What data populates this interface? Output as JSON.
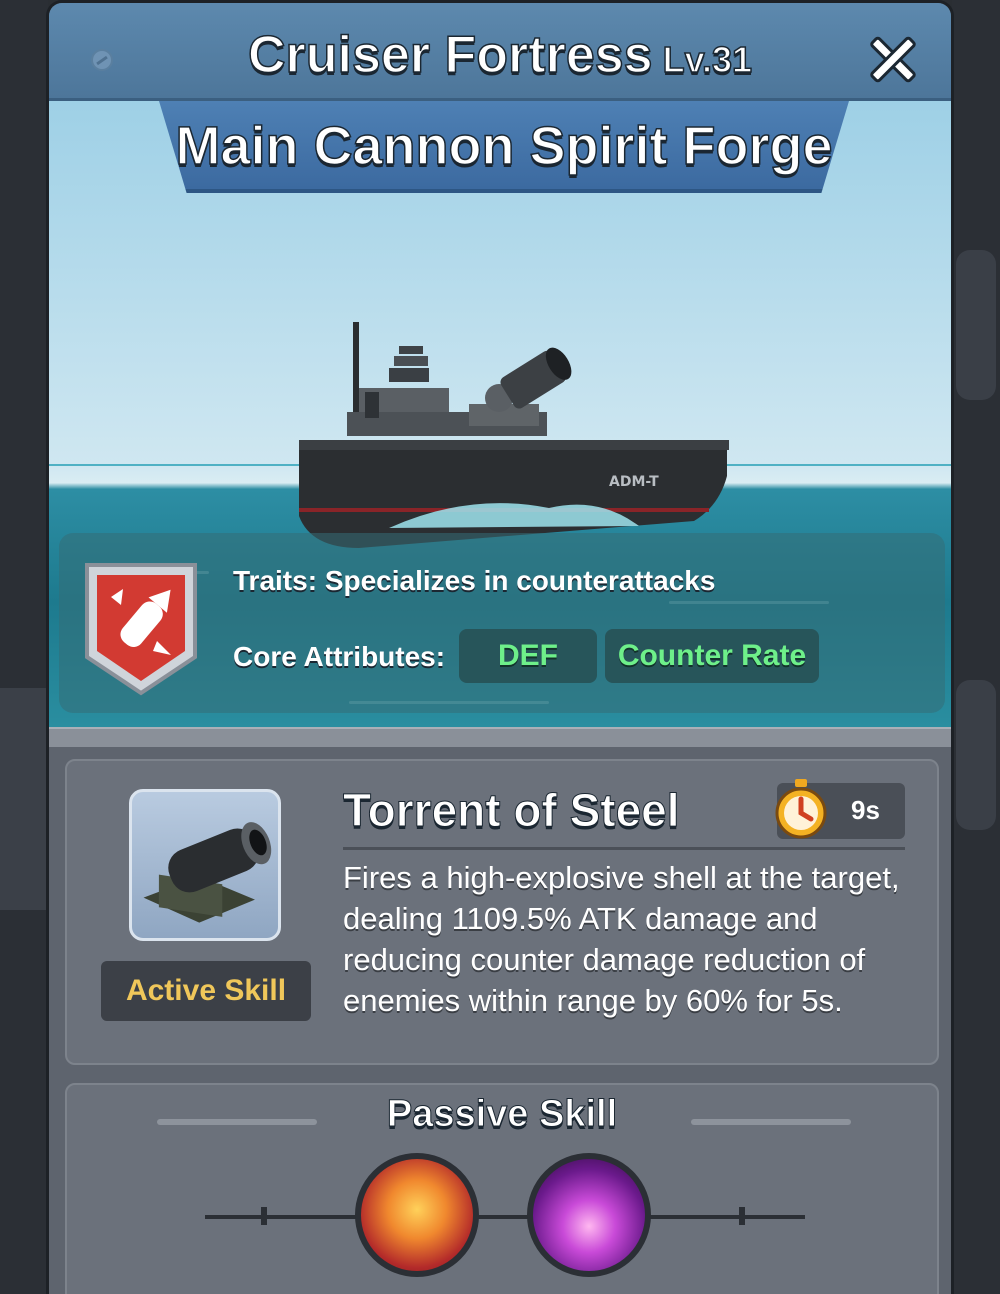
{
  "header": {
    "title": "Cruiser Fortress",
    "level": "Lv.31"
  },
  "banner": {
    "text": "Main Cannon Spirit Forge"
  },
  "ship": {
    "hull_marking": "ADM-T"
  },
  "traits": {
    "label": "Traits:",
    "value": "Specializes in counterattacks",
    "core_label": "Core Attributes:",
    "core_attributes": [
      "DEF",
      "Counter Rate"
    ]
  },
  "active_skill": {
    "type": "Active Skill",
    "name": "Torrent of Steel",
    "cooldown": "9s",
    "description": "Fires a high-explosive shell at the target, dealing 1109.5% ATK damage and reducing counter damage reduction of enemies within range by 60% for 5s."
  },
  "passive_skill": {
    "title": "Passive Skill",
    "icons": [
      "missile-fire-icon",
      "purple-flame-icon"
    ]
  },
  "colors": {
    "title_bar": "#5d89ae",
    "banner": "#4e80b4",
    "attr_text": "#6ef08a",
    "skill_type_text": "#f0c75a",
    "card_bg": "#6b717b"
  }
}
